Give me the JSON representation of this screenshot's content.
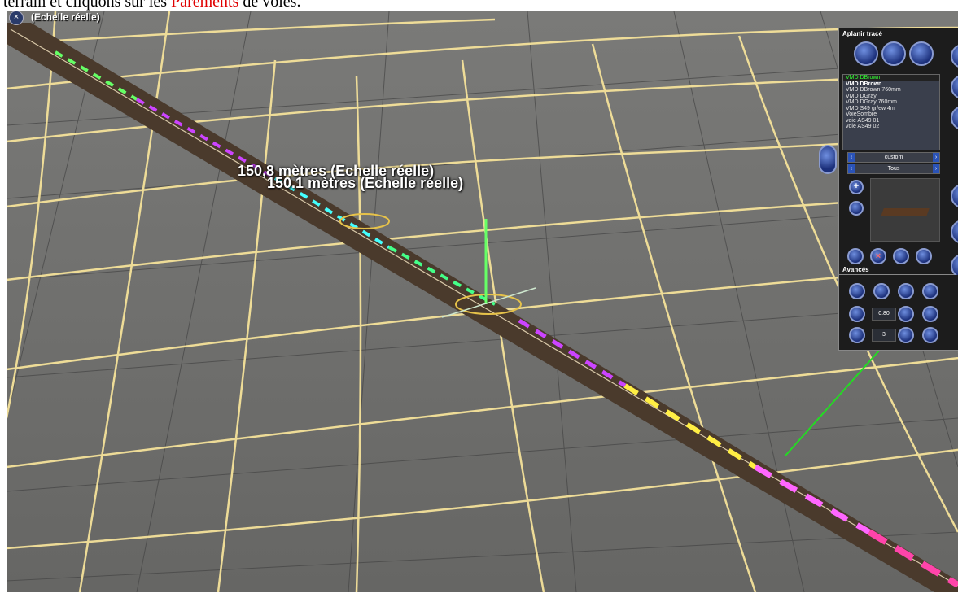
{
  "document": {
    "caption_prefix": "terrain et cliquons sur les ",
    "caption_highlight": "Parements",
    "caption_suffix": " de voies."
  },
  "viewport": {
    "close_icon": "close-icon",
    "scale_label": "(Echelle réelle)",
    "measure_top": "150,8 mètres  (Echelle réelle)",
    "measure_bottom": "150.1 mètres  (Echelle réelle)"
  },
  "panel": {
    "title": "Aplanir tracé",
    "selected_track": "VMD DBrown",
    "track_list": [
      "VMD DBrown",
      "VMD DBrown 760mm",
      "VMD DGray",
      "VMD DGray 760mm",
      "VMD S49 gr/ew 4m",
      "VoieSombre",
      "voie AS49 01",
      "voie AS49 02"
    ],
    "filter_1": "custom",
    "filter_2": "Tous"
  },
  "advanced": {
    "title": "Avancés",
    "value_1": "0.80",
    "value_2": "3"
  },
  "colors": {
    "grid_line": "#f5e29a",
    "ground": "#6f6f6d",
    "track_ballast": "#4a3a2c",
    "arrow": "#22dd22",
    "panel_bg": "#1c1c1c",
    "button_blue": "#2a53b8"
  }
}
